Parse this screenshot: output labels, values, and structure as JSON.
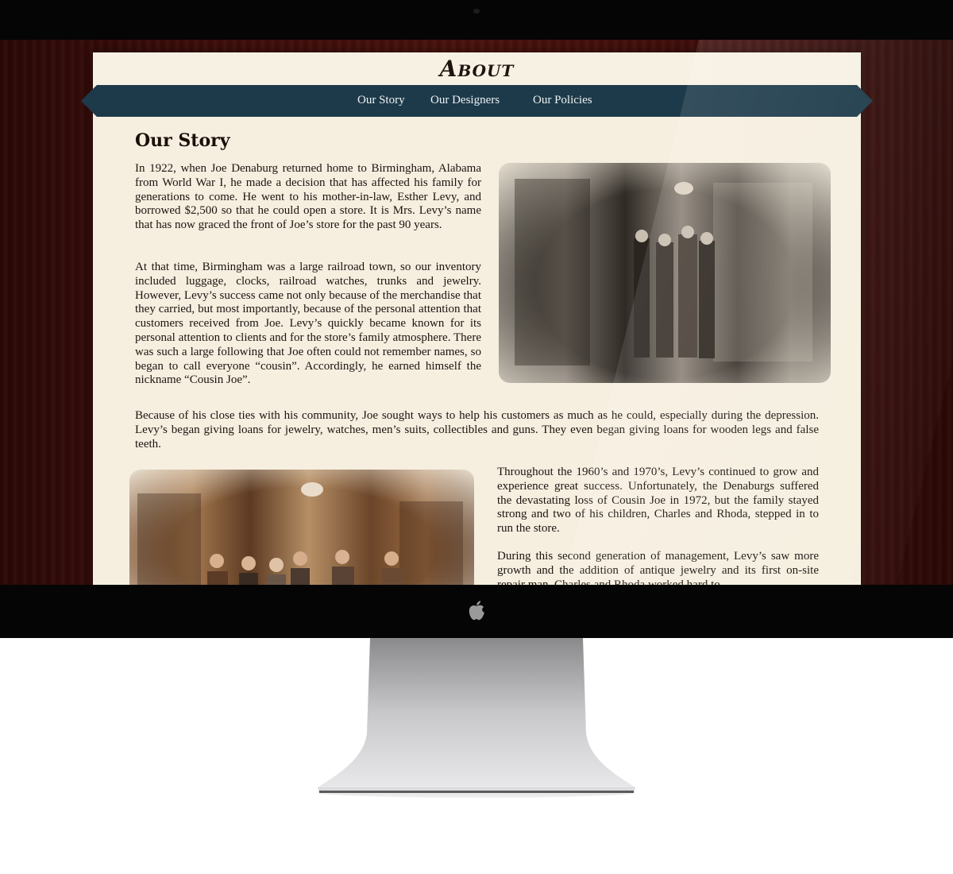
{
  "page": {
    "logo_text": "About",
    "nav": [
      {
        "label": "Our Story"
      },
      {
        "label": "Our Designers"
      },
      {
        "label": "Our Policies"
      }
    ],
    "heading": "Our Story",
    "paragraphs": [
      "In 1922, when Joe Denaburg returned home to Birmingham, Alabama from World War I, he made a decision that has affected his family for generations to come. He went to his mother-in-law, Esther Levy, and borrowed $2,500 so that he could open a store. It is Mrs. Levy’s name that has now graced the front of Joe’s store for the past 90 years.",
      "At that time, Birmingham was a large railroad town, so our inventory included luggage, clocks, railroad watches, trunks and jewelry. However, Levy’s success came not only because of the merchandise that they carried, but most importantly, because of the personal attention that customers received from Joe. Levy’s quickly became known for its personal attention to clients and for the store’s family atmosphere. There was such a large following that Joe often could not remember names, so began to call everyone “cousin”. Accordingly, he earned himself the nickname “Cousin Joe”.",
      "Because of his close ties with his community, Joe sought ways to help his customers as much as he could, especially during the depression. Levy’s began giving loans for jewelry, watches, men’s suits, collectibles and guns. They even began giving loans for wooden legs and false teeth.",
      "Throughout the 1960’s and 1970’s, Levy’s continued to grow and experience great success. Unfortunately, the Denaburgs suffered the devastating loss of Cousin Joe in 1972, but the family stayed strong and two of his children, Charles and Rhoda, stepped in to run the store.",
      "During this second generation of management, Levy’s saw more growth and the addition of antique jewelry and its first on-site repair man. Charles and Rhoda worked hard to"
    ]
  },
  "colors": {
    "nav_bg": "#1d3a4a",
    "page_bg": "#f6efe0",
    "wood": "#3c0d0a"
  },
  "icons": {
    "brand": "apple-logo-icon"
  }
}
